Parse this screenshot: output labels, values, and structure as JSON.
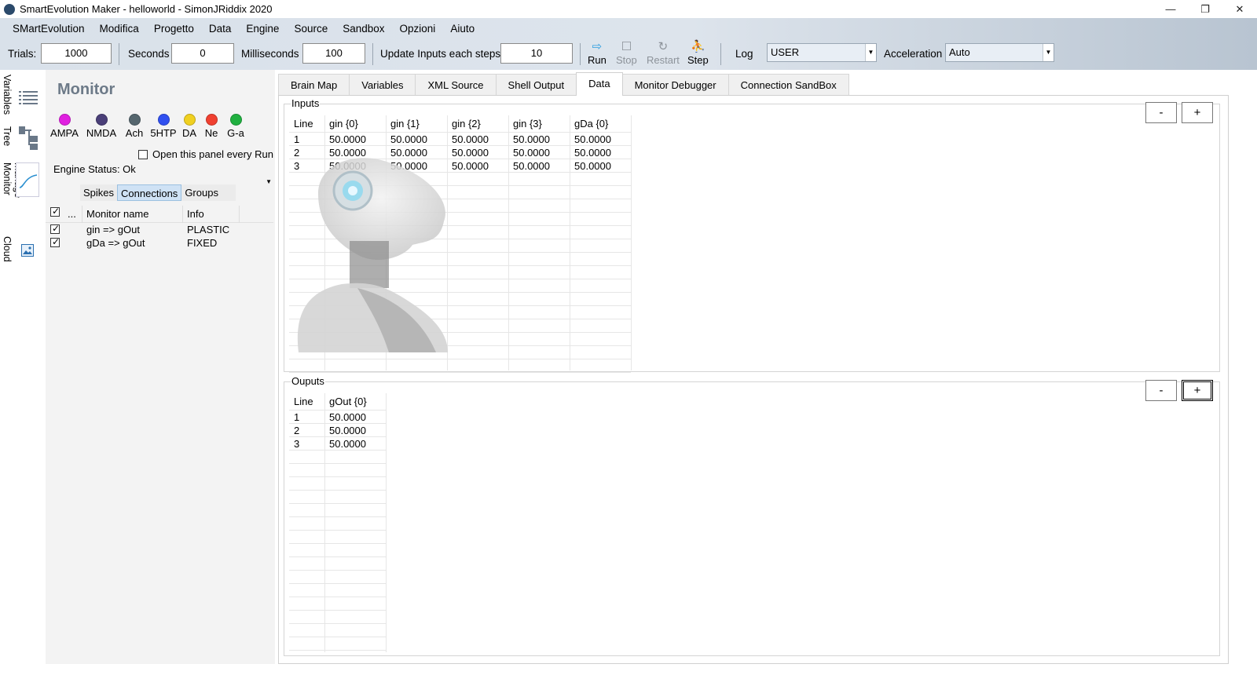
{
  "window": {
    "title": "SmartEvolution Maker - helloworld - SimonJRiddix 2020",
    "controls": {
      "minimize": "—",
      "restore": "❐",
      "close": "✕"
    }
  },
  "menu": [
    "SMartEvolution",
    "Modifica",
    "Progetto",
    "Data",
    "Engine",
    "Source",
    "Sandbox",
    "Opzioni",
    "Aiuto"
  ],
  "toolbar": {
    "trials_label": "Trials:",
    "trials_value": "1000",
    "seconds_label": "Seconds",
    "seconds_value": "0",
    "ms_label": "Milliseconds",
    "ms_value": "100",
    "update_label": "Update Inputs each steps",
    "update_value": "10",
    "run_label": "Run",
    "stop_label": "Stop",
    "restart_label": "Restart",
    "step_label": "Step",
    "log_label": "Log",
    "log_value": "USER",
    "accel_label": "Acceleration",
    "accel_value": "Auto"
  },
  "side_tabs": {
    "variables": "Variables",
    "tree": "Tree",
    "manage_monitor": "Manage Monitor",
    "cloud": "Cloud"
  },
  "monitor": {
    "title": "Monitor",
    "neurotransmitters": [
      {
        "label": "AMPA",
        "color": "#e020e0"
      },
      {
        "label": "NMDA",
        "color": "#4a3f78"
      },
      {
        "label": "Ach",
        "color": "#55666e"
      },
      {
        "label": "5HTP",
        "color": "#3050f0"
      },
      {
        "label": "DA",
        "color": "#f0d020"
      },
      {
        "label": "Ne",
        "color": "#f04030"
      },
      {
        "label": "G-a",
        "color": "#20b040"
      }
    ],
    "open_every_run_label": "Open this panel every Run",
    "engine_status": "Engine Status: Ok",
    "subtabs": [
      "Spikes",
      "Connections",
      "Groups"
    ],
    "table_header": {
      "dots": "...",
      "name": "Monitor name",
      "info": "Info"
    },
    "rows": [
      {
        "name": "gin => gOut",
        "info": "PLASTIC"
      },
      {
        "name": "gDa => gOut",
        "info": "FIXED"
      }
    ]
  },
  "tabs": [
    "Brain Map",
    "Variables",
    "XML Source",
    "Shell Output",
    "Data",
    "Monitor Debugger",
    "Connection SandBox"
  ],
  "inputs": {
    "label": "Inputs",
    "minus": "-",
    "plus": "+",
    "columns": [
      "Line",
      "gin {0}",
      "gin {1}",
      "gin {2}",
      "gin {3}",
      "gDa {0}"
    ],
    "rows": [
      [
        "1",
        "50.0000",
        "50.0000",
        "50.0000",
        "50.0000",
        "50.0000"
      ],
      [
        "2",
        "50.0000",
        "50.0000",
        "50.0000",
        "50.0000",
        "50.0000"
      ],
      [
        "3",
        "50.0000",
        "50.0000",
        "50.0000",
        "50.0000",
        "50.0000"
      ]
    ]
  },
  "outputs": {
    "label": "Ouputs",
    "minus": "-",
    "plus": "+",
    "columns": [
      "Line",
      "gOut {0}"
    ],
    "rows": [
      [
        "1",
        "50.0000"
      ],
      [
        "2",
        "50.0000"
      ],
      [
        "3",
        "50.0000"
      ]
    ]
  }
}
